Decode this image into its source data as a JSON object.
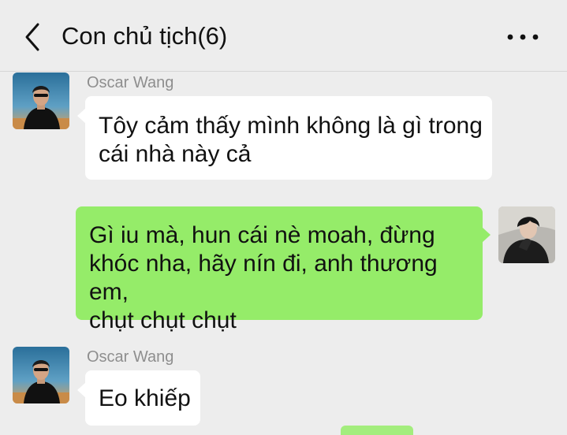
{
  "header": {
    "title": "Con chủ tịch(6)",
    "back_icon": "chevron-left-icon",
    "more_icon": "more-horizontal-icon"
  },
  "messages": [
    {
      "sender": "Oscar Wang",
      "text": "Tôy cảm thấy mình không là gì trong\ncái nhà này cả",
      "direction": "incoming"
    },
    {
      "sender": "",
      "text": "Gì iu mà, hun cái nè moah, đừng\nkhóc nha, hãy nín đi, anh thương em,\nchụt chụt chụt",
      "direction": "outgoing"
    },
    {
      "sender": "Oscar Wang",
      "text": "Eo khiếp",
      "direction": "incoming"
    }
  ],
  "colors": {
    "background": "#ededed",
    "incoming_bubble": "#ffffff",
    "outgoing_bubble": "#95ec69",
    "sender_name": "#8e8e8e"
  }
}
